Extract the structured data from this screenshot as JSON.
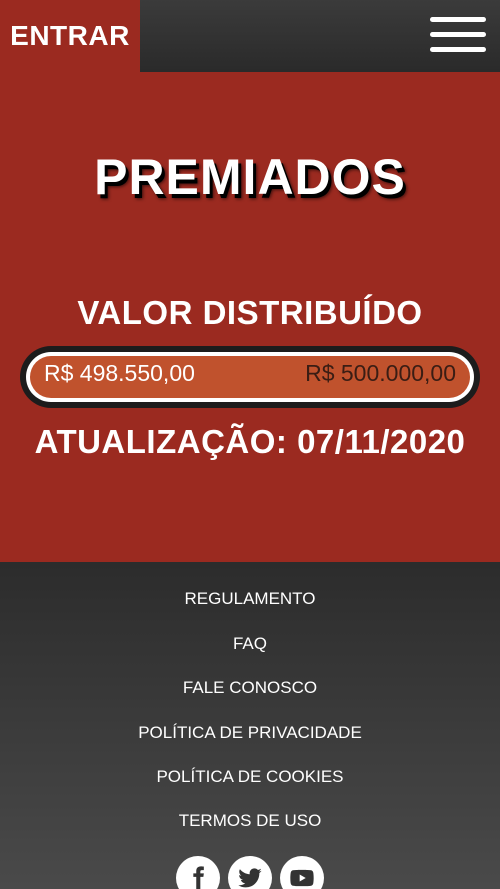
{
  "header": {
    "enter_label": "ENTRAR",
    "menu_icon": "hamburger-menu-icon"
  },
  "hero": {
    "title": "PREMIADOS",
    "label": "VALOR DISTRIBUÍDO",
    "progress": {
      "current_text": "R$ 498.550,00",
      "target_text": "R$ 500.000,00",
      "fraction": 0.9971
    },
    "update_text": "ATUALIZAÇÃO: 07/11/2020"
  },
  "footer": {
    "links": [
      {
        "label": "REGULAMENTO"
      },
      {
        "label": "FAQ"
      },
      {
        "label": "FALE CONOSCO"
      },
      {
        "label": "POLÍTICA DE PRIVACIDADE"
      },
      {
        "label": "POLÍTICA DE COOKIES"
      },
      {
        "label": "TERMOS DE USO"
      }
    ],
    "social": [
      "facebook-icon",
      "twitter-icon",
      "youtube-icon"
    ]
  },
  "colors": {
    "brand_red": "#9b2a20",
    "bar_fill": "#c0522d",
    "dark": "#2c2c2c"
  }
}
